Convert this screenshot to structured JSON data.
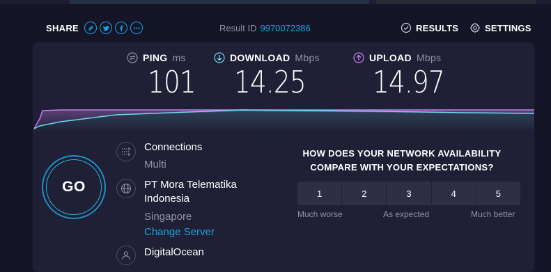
{
  "header": {
    "share_label": "SHARE",
    "share_buttons": [
      {
        "icon": "link-icon"
      },
      {
        "icon": "twitter-icon"
      },
      {
        "icon": "facebook-icon"
      },
      {
        "icon": "more-icon"
      }
    ],
    "result_label": "Result ID",
    "result_id": "9970072386",
    "results_label": "RESULTS",
    "settings_label": "SETTINGS"
  },
  "metrics": {
    "ping": {
      "label": "PING",
      "unit": "ms",
      "value": "101",
      "icon": "ping-icon",
      "color": "#ffffff"
    },
    "download": {
      "label": "DOWNLOAD",
      "unit": "Mbps",
      "value": "14.25",
      "icon": "download-arrow-icon",
      "color": "#6fd9f0"
    },
    "upload": {
      "label": "UPLOAD",
      "unit": "Mbps",
      "value": "14.97",
      "icon": "upload-arrow-icon",
      "color": "#c77ef2"
    }
  },
  "go_label": "GO",
  "connections": {
    "title": "Connections",
    "value": "Multi",
    "icon": "connections-icon"
  },
  "isp": {
    "name_line1": "PT Mora Telematika",
    "name_line2": "Indonesia",
    "location": "Singapore",
    "change_server": "Change Server",
    "icon": "globe-icon"
  },
  "host": {
    "name": "DigitalOcean",
    "icon": "user-icon"
  },
  "survey": {
    "question_line1": "HOW DOES YOUR NETWORK AVAILABILITY",
    "question_line2": "COMPARE WITH YOUR EXPECTATIONS?",
    "options": [
      "1",
      "2",
      "3",
      "4",
      "5"
    ],
    "label_low": "Much worse",
    "label_mid": "As expected",
    "label_high": "Much better"
  },
  "colors": {
    "accent": "#1ca2e0",
    "download": "#6fd9f0",
    "upload": "#c77ef2",
    "background": "#141526",
    "panel": "#1f2035"
  }
}
